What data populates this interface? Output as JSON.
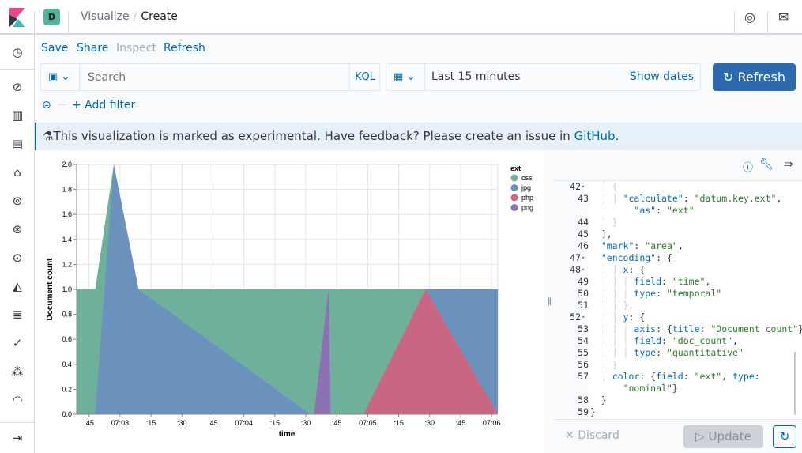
{
  "header": {
    "breadcrumbs": [
      "Visualize",
      "Create"
    ],
    "avatar": "D",
    "separator": "/"
  },
  "menu": {
    "save": "Save",
    "share": "Share",
    "inspect": "Inspect",
    "refresh": "Refresh"
  },
  "query": {
    "placeholder": "Search",
    "language": "KQL",
    "add_filter": "+ Add filter"
  },
  "time": {
    "range": "Last 15 minutes",
    "show_dates": "Show dates",
    "refresh": "Refresh"
  },
  "banner": {
    "text": "This visualization is marked as experimental. Have feedback? Please create an issue in ",
    "link": "GitHub",
    "end": "."
  },
  "editor": {
    "discard": "Discard",
    "update": "Update",
    "lines": [
      {
        "n": "42",
        "fold": true,
        "t": "  │ {"
      },
      {
        "n": "43",
        "t": "  │ │ \"calculate\": \"datum.key.ext\","
      },
      {
        "n": "",
        "t": "        \"as\": \"ext\""
      },
      {
        "n": "44",
        "t": "  │ }"
      },
      {
        "n": "45",
        "t": "  ],"
      },
      {
        "n": "46",
        "t": "  \"mark\": \"area\","
      },
      {
        "n": "47",
        "fold": true,
        "t": "  \"encoding\": {"
      },
      {
        "n": "48",
        "fold": true,
        "t": "  │ │ x: {"
      },
      {
        "n": "49",
        "t": "  │ │ │ field: \"time\","
      },
      {
        "n": "50",
        "t": "  │ │ │ type: \"temporal\""
      },
      {
        "n": "51",
        "t": "  │ │ },"
      },
      {
        "n": "52",
        "fold": true,
        "t": "  │ │ y: {"
      },
      {
        "n": "53",
        "t": "  │ │ │ axis: {title: \"Document count\"}"
      },
      {
        "n": "54",
        "t": "  │ │ │ field: \"doc_count\","
      },
      {
        "n": "55",
        "t": "  │ │ │ type: \"quantitative\""
      },
      {
        "n": "56",
        "t": "  │ }"
      },
      {
        "n": "57",
        "t": "  │ color: {field: \"ext\", type:"
      },
      {
        "n": "",
        "t": "      \"nominal\"}"
      },
      {
        "n": "58",
        "t": "  }"
      },
      {
        "n": "59",
        "t": "}"
      }
    ]
  },
  "chart_data": {
    "type": "area",
    "xlabel": "time",
    "ylabel": "Document count",
    "xlim": [
      "07:02:39",
      "07:06:03"
    ],
    "ylim": [
      0,
      2
    ],
    "yticks": [
      "0.0",
      "0.2",
      "0.4",
      "0.6",
      "0.8",
      "1.0",
      "1.2",
      "1.4",
      "1.6",
      "1.8",
      "2.0"
    ],
    "xticks": [
      {
        "t": "07:02:45",
        "label": ":45"
      },
      {
        "t": "07:03:00",
        "label": "07:03"
      },
      {
        "t": "07:03:15",
        "label": ":15"
      },
      {
        "t": "07:03:30",
        "label": ":30"
      },
      {
        "t": "07:03:45",
        "label": ":45"
      },
      {
        "t": "07:04:00",
        "label": "07:04"
      },
      {
        "t": "07:04:15",
        "label": ":15"
      },
      {
        "t": "07:04:30",
        "label": ":30"
      },
      {
        "t": "07:04:45",
        "label": ":45"
      },
      {
        "t": "07:05:00",
        "label": "07:05"
      },
      {
        "t": "07:05:15",
        "label": ":15"
      },
      {
        "t": "07:05:30",
        "label": ":30"
      },
      {
        "t": "07:05:45",
        "label": ":45"
      },
      {
        "t": "07:06:00",
        "label": "07:06"
      }
    ],
    "grid": true,
    "legend": {
      "title": "ext",
      "placement": "right"
    },
    "series": [
      {
        "name": "css",
        "color": "#6eb09a",
        "polygons": [
          [
            [
              "07:02:39",
              0
            ],
            [
              "07:02:39",
              1
            ],
            [
              "07:02:48",
              1
            ],
            [
              "07:02:57",
              2
            ],
            [
              "07:03:09",
              1
            ],
            [
              "07:06:03",
              1
            ],
            [
              "07:06:03",
              0
            ]
          ]
        ]
      },
      {
        "name": "jpg",
        "color": "#6b91bd",
        "polygons": [
          [
            [
              "07:02:48",
              0
            ],
            [
              "07:02:57",
              2
            ],
            [
              "07:03:09",
              1
            ],
            [
              "07:04:32",
              0
            ]
          ],
          [
            [
              "07:05:28",
              1
            ],
            [
              "07:06:03",
              1
            ],
            [
              "07:06:03",
              0
            ]
          ]
        ]
      },
      {
        "name": "php",
        "color": "#c96783",
        "polygons": [
          [
            [
              "07:04:58",
              0
            ],
            [
              "07:05:28",
              1
            ],
            [
              "07:06:03",
              0
            ]
          ]
        ]
      },
      {
        "name": "png",
        "color": "#8c72b4",
        "polygons": [
          [
            [
              "07:04:34",
              0
            ],
            [
              "07:04:41",
              1
            ],
            [
              "07:04:42",
              0
            ]
          ]
        ]
      }
    ]
  }
}
